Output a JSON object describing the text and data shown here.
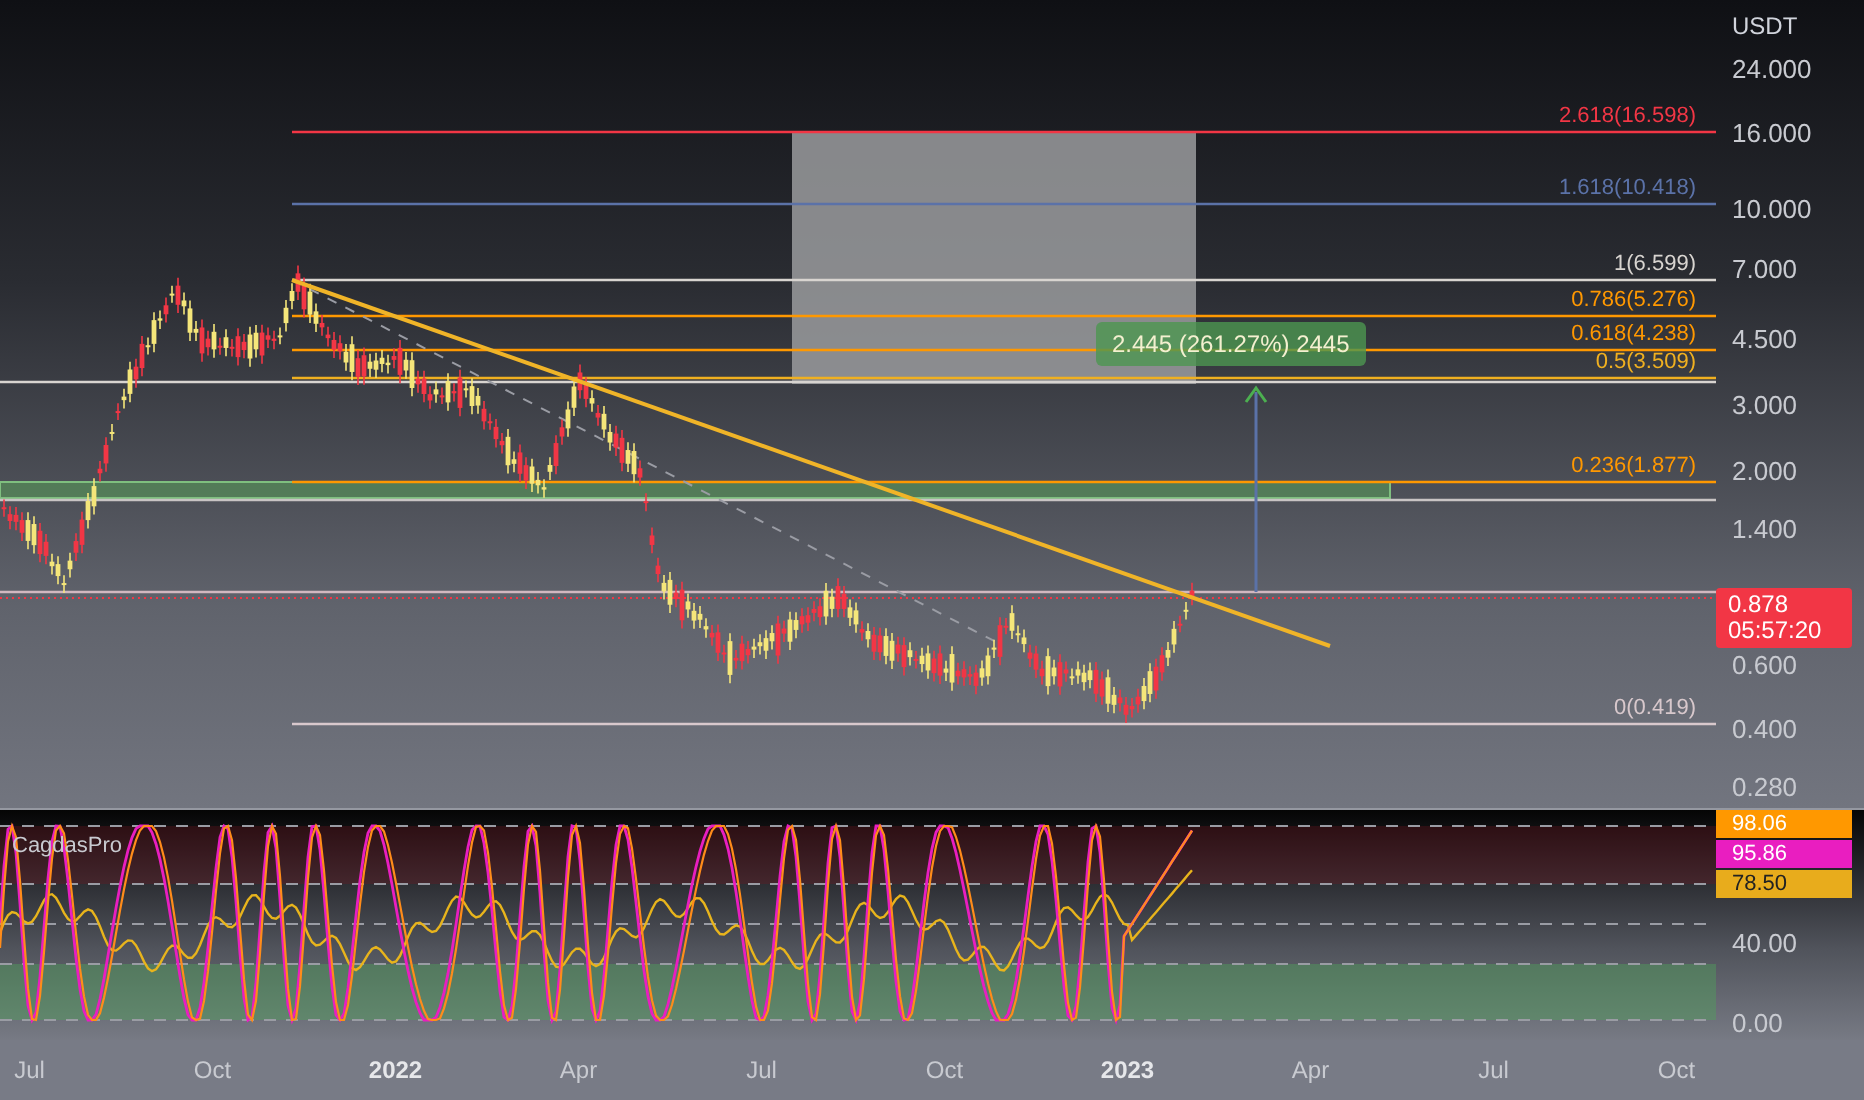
{
  "price_axis": {
    "currency": "USDT",
    "ticks": [
      "24.000",
      "16.000",
      "10.000",
      "7.000",
      "4.500",
      "3.000",
      "2.000",
      "1.400",
      "0.600",
      "0.400",
      "0.280"
    ]
  },
  "current_price": {
    "price": "0.878",
    "countdown": "05:57:20"
  },
  "fib_levels": [
    {
      "label": "2.618(16.598)",
      "color": "#f23645"
    },
    {
      "label": "1.618(10.418)",
      "color": "#5b72a8"
    },
    {
      "label": "1(6.599)",
      "color": "#d8d4d0"
    },
    {
      "label": "0.786(5.276)",
      "color": "#ff9800"
    },
    {
      "label": "0.618(4.238)",
      "color": "#ff9800"
    },
    {
      "label": "0.5(3.509)",
      "color": "#f0b020"
    },
    {
      "label": "0.236(1.877)",
      "color": "#ff9800"
    },
    {
      "label": "0(0.419)",
      "color": "#d8c8cc"
    }
  ],
  "measure": {
    "label": "2.445 (261.27%) 2445"
  },
  "indicator": {
    "name": "CagdasPro",
    "values": [
      {
        "value": "98.06",
        "color": "#ff9800"
      },
      {
        "value": "95.86",
        "color": "#e91ec0"
      },
      {
        "value": "78.50",
        "color": "#e8ac1c"
      }
    ],
    "ticks": [
      "40.00",
      "0.00"
    ]
  },
  "time_axis": [
    {
      "label": "Jul",
      "kind": "month"
    },
    {
      "label": "Oct",
      "kind": "month"
    },
    {
      "label": "2022",
      "kind": "year"
    },
    {
      "label": "Apr",
      "kind": "month"
    },
    {
      "label": "Jul",
      "kind": "month"
    },
    {
      "label": "Oct",
      "kind": "month"
    },
    {
      "label": "2023",
      "kind": "year"
    },
    {
      "label": "Apr",
      "kind": "month"
    },
    {
      "label": "Jul",
      "kind": "month"
    },
    {
      "label": "Oct",
      "kind": "month"
    }
  ]
}
